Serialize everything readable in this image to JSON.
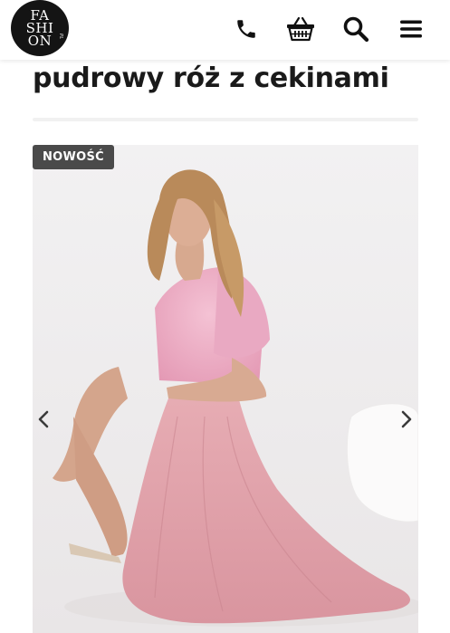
{
  "header": {
    "logo_lines": [
      "FA",
      "SHI",
      "ON"
    ],
    "logo_suffix": "PL",
    "icons": [
      "phone-icon",
      "basket-icon",
      "search-icon",
      "menu-icon"
    ]
  },
  "product": {
    "title": "pudrowy róż z cekinami",
    "badge": "NOWOŚĆ",
    "image_alt": "model in powder pink sequin dress with tulle skirt"
  },
  "gallery": {
    "prev_icon": "chevron-left-icon",
    "next_icon": "chevron-right-icon"
  },
  "colors": {
    "logo_bg": "#141414",
    "badge_bg": "#4a4a4a",
    "dress_pink": "#e3a5ad",
    "background": "#efedee"
  }
}
